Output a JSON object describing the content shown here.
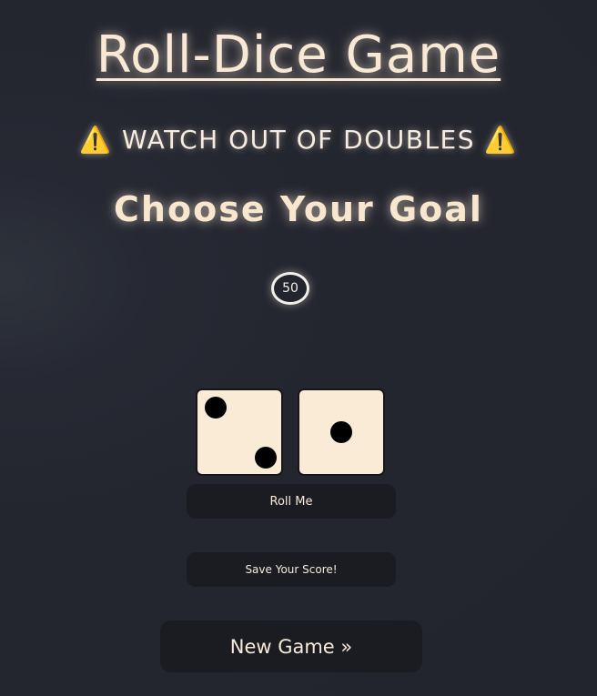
{
  "header": {
    "title": "Roll-Dice Game",
    "warning": "⚠️ WATCH OUT OF DOUBLES ⚠️",
    "goal_heading": "Choose Your Goal"
  },
  "goal": {
    "value": "50"
  },
  "dice": [
    {
      "face": 2
    },
    {
      "face": 1
    }
  ],
  "buttons": {
    "roll_label": "Roll Me",
    "save_label": "Save Your Score!",
    "new_game_label": "New Game »"
  },
  "colors": {
    "background": "#23252e",
    "text": "#faebd7",
    "die_face": "#faebd7",
    "pip": "#000000",
    "button_bg": "#1b1c21"
  }
}
